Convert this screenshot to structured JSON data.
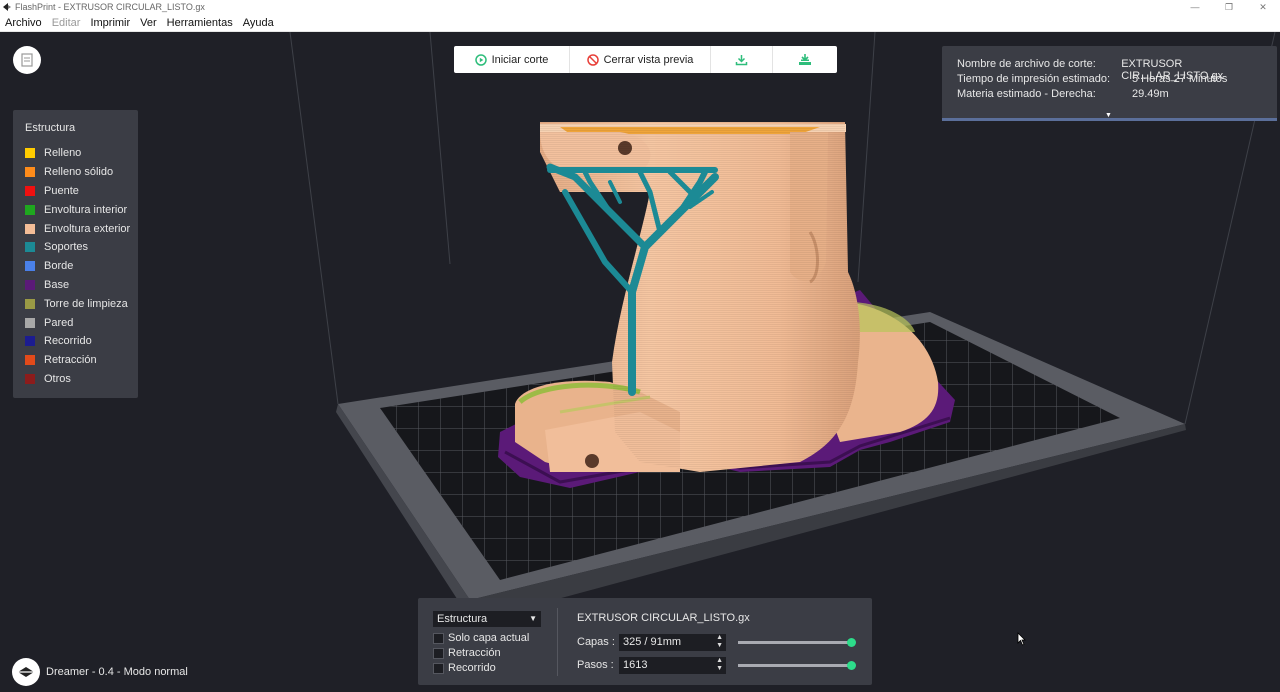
{
  "window": {
    "title": "FlashPrint - EXTRUSOR CIRCULAR_LISTO.gx",
    "controls": [
      "—",
      "❐",
      "✕"
    ]
  },
  "menu": {
    "items": [
      {
        "label": "Archivo",
        "enabled": true
      },
      {
        "label": "Editar",
        "enabled": false
      },
      {
        "label": "Imprimir",
        "enabled": true
      },
      {
        "label": "Ver",
        "enabled": true
      },
      {
        "label": "Herramientas",
        "enabled": true
      },
      {
        "label": "Ayuda",
        "enabled": true
      }
    ]
  },
  "toolbar": {
    "start_slice": "Iniciar corte",
    "close_preview": "Cerrar vista previa",
    "start_color": "#2ebd7b",
    "close_color": "#e8403a"
  },
  "legend": {
    "title": "Estructura",
    "items": [
      {
        "label": "Relleno",
        "color": "#ffcc00"
      },
      {
        "label": "Relleno sólido",
        "color": "#ff8c1a"
      },
      {
        "label": "Puente",
        "color": "#f01010"
      },
      {
        "label": "Envoltura interior",
        "color": "#1fa81f"
      },
      {
        "label": "Envoltura exterior",
        "color": "#f4bd97"
      },
      {
        "label": "Soportes",
        "color": "#1c8a95"
      },
      {
        "label": "Borde",
        "color": "#4a80e8"
      },
      {
        "label": "Base",
        "color": "#5b1a78"
      },
      {
        "label": "Torre de limpieza",
        "color": "#9a9a45"
      },
      {
        "label": "Pared",
        "color": "#a8a8a8"
      },
      {
        "label": "Recorrido",
        "color": "#1c1c90"
      },
      {
        "label": "Retracción",
        "color": "#e24a1a"
      },
      {
        "label": "Otros",
        "color": "#8c1c1c"
      }
    ]
  },
  "info": {
    "rows": [
      {
        "key": "Nombre de archivo de corte:",
        "value": "EXTRUSOR CIR...LAR_LISTO.gx"
      },
      {
        "key": "Tiempo de impresión estimado:",
        "value": "5 Horas 27 Minutos"
      },
      {
        "key": "Materia estimado - Derecha:",
        "value": "29.49m"
      }
    ]
  },
  "status": {
    "printer": "Dreamer - 0.4 - Modo normal"
  },
  "controls": {
    "view_mode": "Estructura",
    "checkboxes": [
      {
        "label": "Solo capa actual",
        "checked": false
      },
      {
        "label": "Retracción",
        "checked": false
      },
      {
        "label": "Recorrido",
        "checked": false
      }
    ],
    "filename": "EXTRUSOR CIRCULAR_LISTO.gx",
    "layers_label": "Capas :",
    "layers_value": "325 / 91mm",
    "steps_label": "Pasos :",
    "steps_value": "1613",
    "layers_slider_fraction": 1.0,
    "steps_slider_fraction": 1.0,
    "slider_knob_color": "#2ddc8a"
  }
}
